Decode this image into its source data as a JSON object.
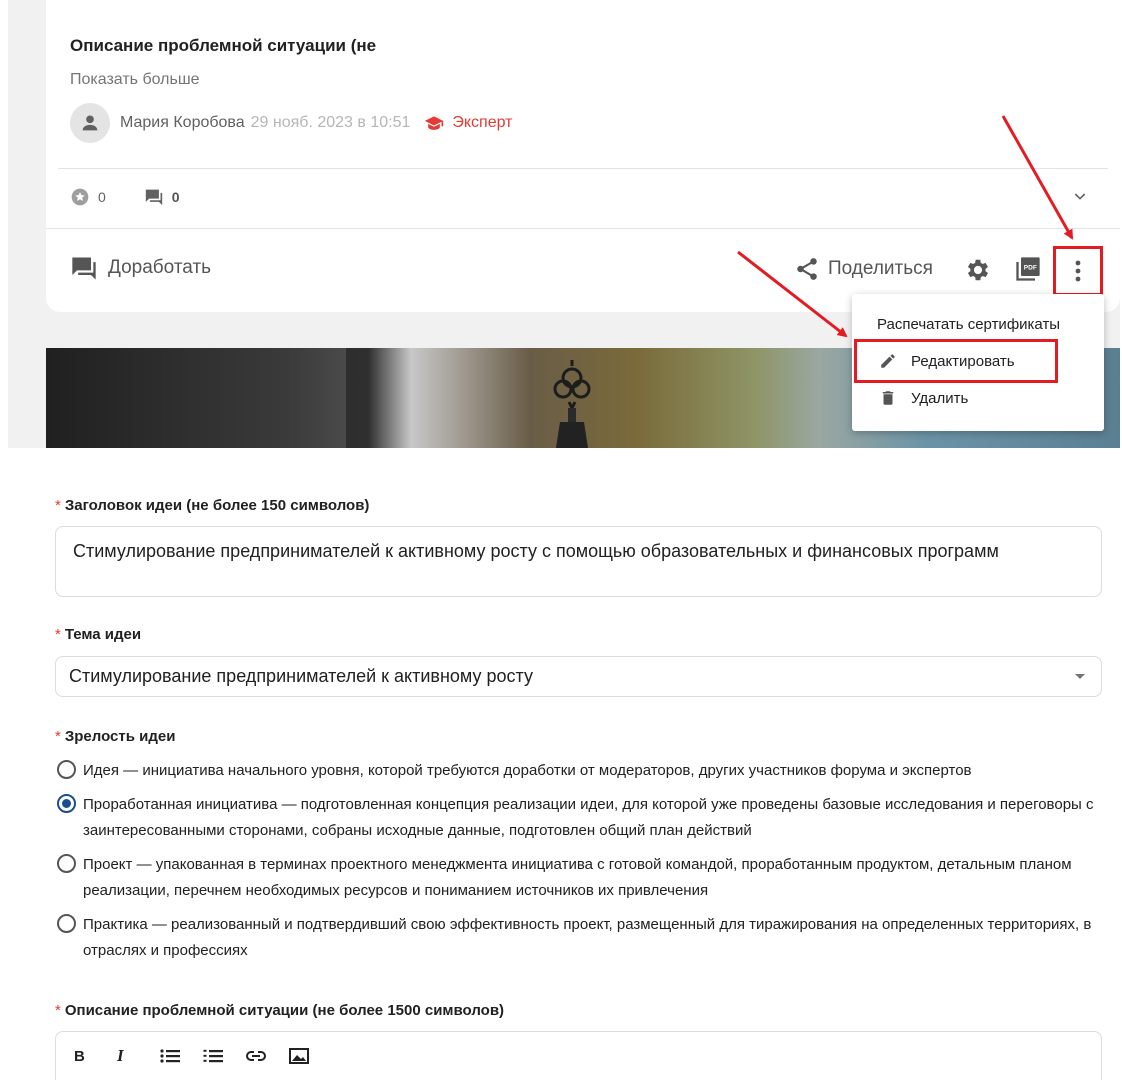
{
  "card": {
    "title": "Описание проблемной ситуации (не",
    "show_more": "Показать больше",
    "author": {
      "name": "Мария Коробова",
      "date": "29 нояб. 2023 в 10:51",
      "badge": "Эксперт"
    },
    "stats": {
      "rating": "0",
      "comments": "0"
    },
    "actions": {
      "rework": "Доработать",
      "share": "Поделиться"
    }
  },
  "menu": {
    "items": [
      {
        "label": "Распечатать сертификаты"
      },
      {
        "label": "Редактировать",
        "icon": "pencil-icon"
      },
      {
        "label": "Удалить",
        "icon": "trash-icon"
      }
    ]
  },
  "form": {
    "title_field": {
      "label": "Заголовок идеи (не более 150 символов)",
      "value": "Стимулирование предпринимателей к активному росту с помощью образовательных и финансовых программ"
    },
    "topic_field": {
      "label": "Тема идеи",
      "value": "Стимулирование предпринимателей к активному росту"
    },
    "maturity_field": {
      "label": "Зрелость идеи",
      "selected_index": 1,
      "options": [
        "Идея — инициатива начального уровня, которой требуются доработки от модераторов, других участников форума и экспертов",
        "Проработанная инициатива — подготовленная концепция реализации идеи, для которой уже проведены базовые исследования и переговоры с заинтересованными сторонами, собраны исходные данные, подготовлен общий план действий",
        "Проект — упакованная в терминах проектного менеджмента инициатива с готовой командой, проработанным продуктом, детальным планом реализации, перечнем необходимых ресурсов и пониманием источников их привлечения",
        "Практика — реализованный и подтвердивший свою эффективность проект, размещенный для тиражирования на определенных территориях, в отраслях и профессиях"
      ]
    },
    "description_field": {
      "label": "Описание проблемной ситуации (не более 1500 символов)",
      "toolbar": {
        "bold": "B",
        "italic": "I"
      }
    },
    "required_mark": "*"
  },
  "colors": {
    "accent_red": "#e31b23",
    "expert_red": "#e53935",
    "radio_blue": "#1a4d8f"
  }
}
